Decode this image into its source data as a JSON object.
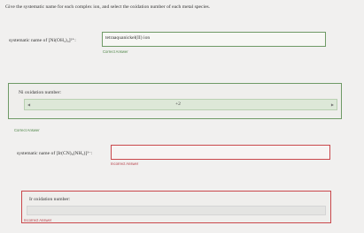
{
  "instructions": "Give the systematic name for each complex ion, and select the oxidation number of each metal species.",
  "q1": {
    "label": "systematic name of [Ni(OH₂)₄]²⁺:",
    "answer": "tetraaquanickel(II) ion",
    "feedback": "Correct Answer"
  },
  "q2": {
    "label": "Ni oxidation number:",
    "value": "+2",
    "feedback": "Correct Answer"
  },
  "q3": {
    "label": "systematic name of [Ir(CN)₆(NH₃)]³⁻:",
    "answer": "",
    "feedback": "Incorrect Answer"
  },
  "q4": {
    "label": "Ir oxidation number:",
    "value": "",
    "feedback": "Incorrect Answer"
  }
}
